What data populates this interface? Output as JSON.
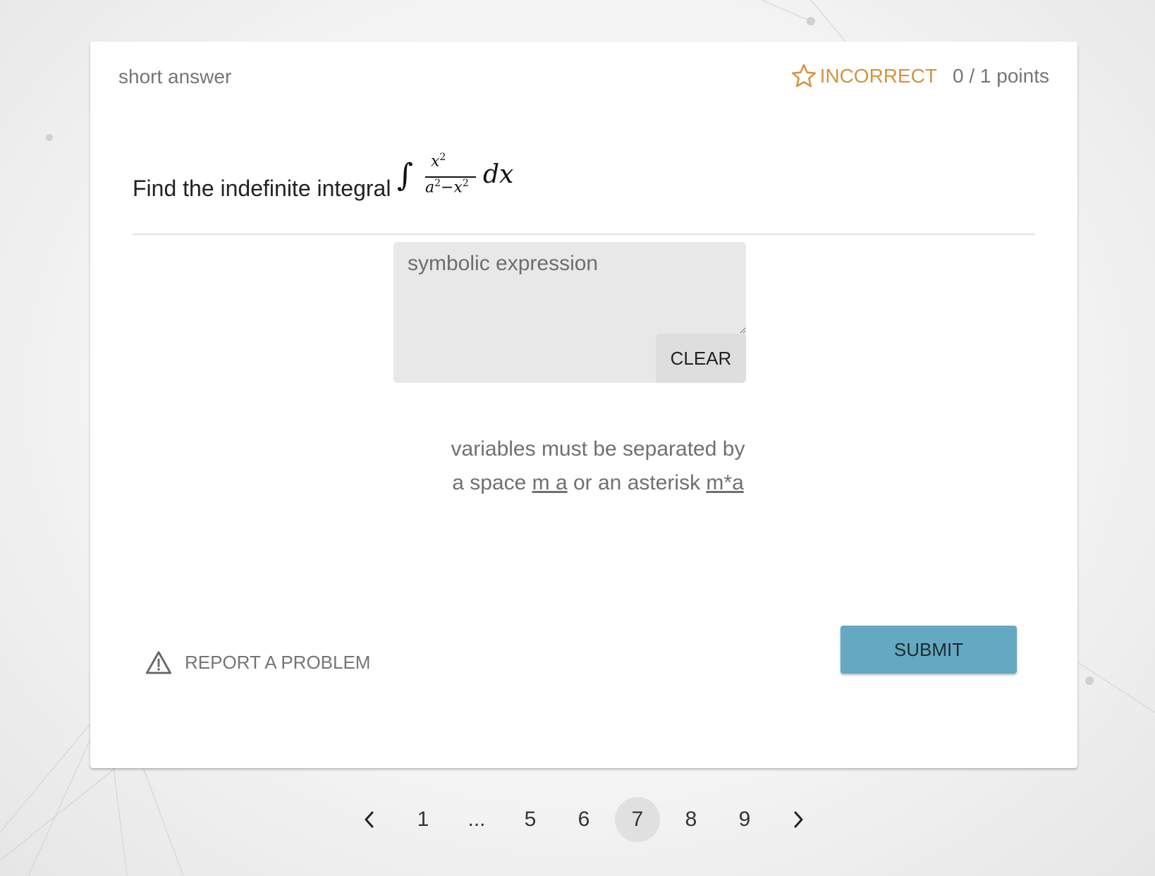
{
  "question": {
    "type_label": "short answer",
    "status": "INCORRECT",
    "points": "0 / 1 points",
    "text": "Find the indefinite integral",
    "math": {
      "integral": "∫",
      "numerator_base": "x",
      "numerator_exp": "2",
      "denominator": "a",
      "denominator_exp": "2",
      "denominator_op": "−x",
      "denominator_exp2": "2",
      "differential": "dx"
    }
  },
  "answer": {
    "placeholder": "symbolic expression",
    "value": "",
    "clear_label": "CLEAR"
  },
  "hint": {
    "line1": "variables must be separated by",
    "line2_prefix": "a space ",
    "example_space": "m a",
    "line2_middle": " or an asterisk ",
    "example_asterisk": "m*a"
  },
  "report_label": "REPORT A PROBLEM",
  "submit_label": "SUBMIT",
  "pagination": {
    "prev_icon": "chevron-left-icon",
    "next_icon": "chevron-right-icon",
    "pages": [
      "1",
      "...",
      "5",
      "6",
      "7",
      "8",
      "9"
    ],
    "current": "7"
  },
  "colors": {
    "incorrect": "#d4933e",
    "submit_bg": "#64a9c1",
    "answer_bg": "#e8e8e8"
  }
}
